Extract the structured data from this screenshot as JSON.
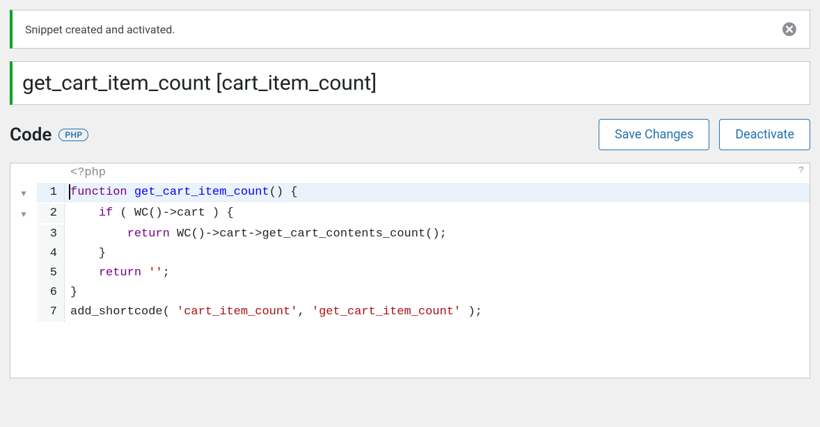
{
  "notice": {
    "text": "Snippet created and activated."
  },
  "title": {
    "value": "get_cart_item_count [cart_item_count]"
  },
  "section": {
    "label": "Code",
    "lang_badge": "PHP"
  },
  "buttons": {
    "save": "Save Changes",
    "deactivate": "Deactivate"
  },
  "editor": {
    "help": "?",
    "php_open": "<?php",
    "fold_marker": "▼",
    "lines": [
      {
        "n": "1",
        "fold": true,
        "current": true
      },
      {
        "n": "2",
        "fold": true
      },
      {
        "n": "3"
      },
      {
        "n": "4"
      },
      {
        "n": "5"
      },
      {
        "n": "6"
      },
      {
        "n": "7"
      }
    ],
    "code": {
      "l1": {
        "kw": "function",
        "def": "get_cart_item_count",
        "rest": "() {"
      },
      "l2": {
        "indent": "    ",
        "kw": "if",
        "rest1": " ( ",
        "func": "WC",
        "rest2": "()",
        "op": "->",
        "prop": "cart",
        "rest3": " ) {"
      },
      "l3": {
        "indent": "        ",
        "kw": "return",
        "rest1": " ",
        "func1": "WC",
        "rest2": "()",
        "op1": "->",
        "prop1": "cart",
        "op2": "->",
        "func2": "get_cart_contents_count",
        "rest3": "();"
      },
      "l4": {
        "indent": "    ",
        "rest": "}"
      },
      "l5": {
        "indent": "    ",
        "kw": "return",
        "rest1": " ",
        "str": "''",
        "rest2": ";"
      },
      "l6": {
        "rest": "}"
      },
      "l7": {
        "func": "add_shortcode",
        "rest1": "( ",
        "str1": "'cart_item_count'",
        "rest2": ", ",
        "str2": "'get_cart_item_count'",
        "rest3": " );"
      }
    }
  }
}
